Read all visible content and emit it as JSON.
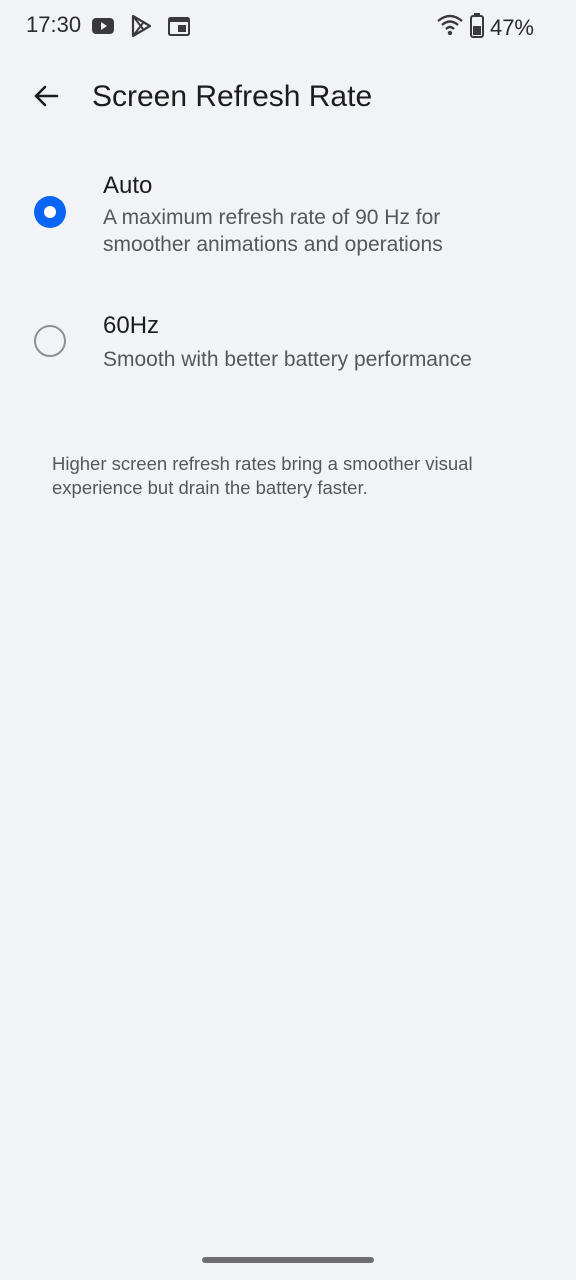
{
  "status_bar": {
    "time": "17:30",
    "notification_icons": [
      "youtube-icon",
      "play-store-icon",
      "calendar-icon"
    ],
    "battery_percent": "47%",
    "wifi_icon": "wifi-icon",
    "battery_icon": "battery-icon"
  },
  "app_bar": {
    "back_icon": "arrow-left-icon",
    "title": "Screen Refresh Rate"
  },
  "options": [
    {
      "title": "Auto",
      "description": "A maximum refresh rate of 90 Hz for smoother animations and operations",
      "selected": true
    },
    {
      "title": "60Hz",
      "description": "Smooth with better battery performance",
      "selected": false
    }
  ],
  "footer_note": "Higher screen refresh rates bring a smoother visual experience but drain the battery faster.",
  "colors": {
    "background": "#f2f3f6",
    "accent": "#0a64f4",
    "text_primary": "#1c1c1f",
    "text_secondary": "#55575c"
  }
}
